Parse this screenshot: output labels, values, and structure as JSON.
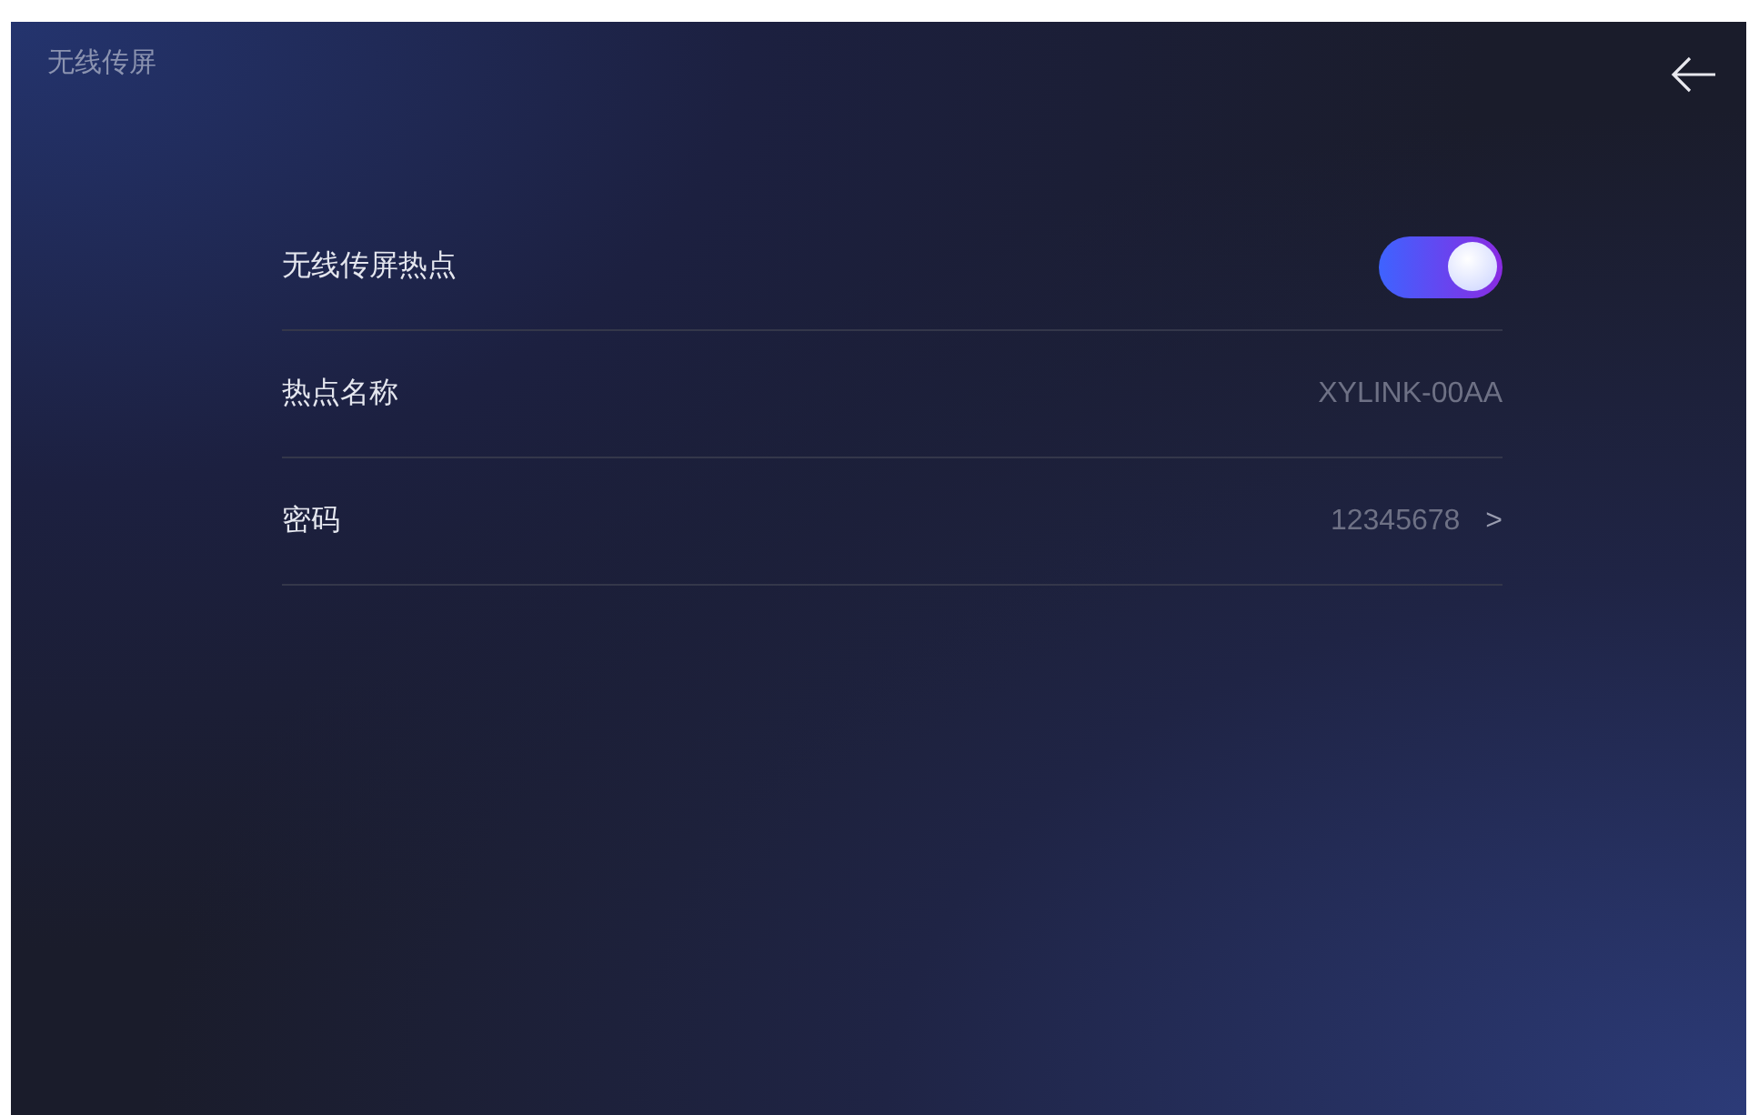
{
  "header": {
    "title": "无线传屏"
  },
  "settings": [
    {
      "kind": "toggle",
      "label": "无线传屏热点",
      "on": true
    },
    {
      "kind": "text",
      "label": "热点名称",
      "value": "XYLINK-00AA"
    },
    {
      "kind": "link",
      "label": "密码",
      "value": "12345678",
      "chevron": ">"
    }
  ]
}
